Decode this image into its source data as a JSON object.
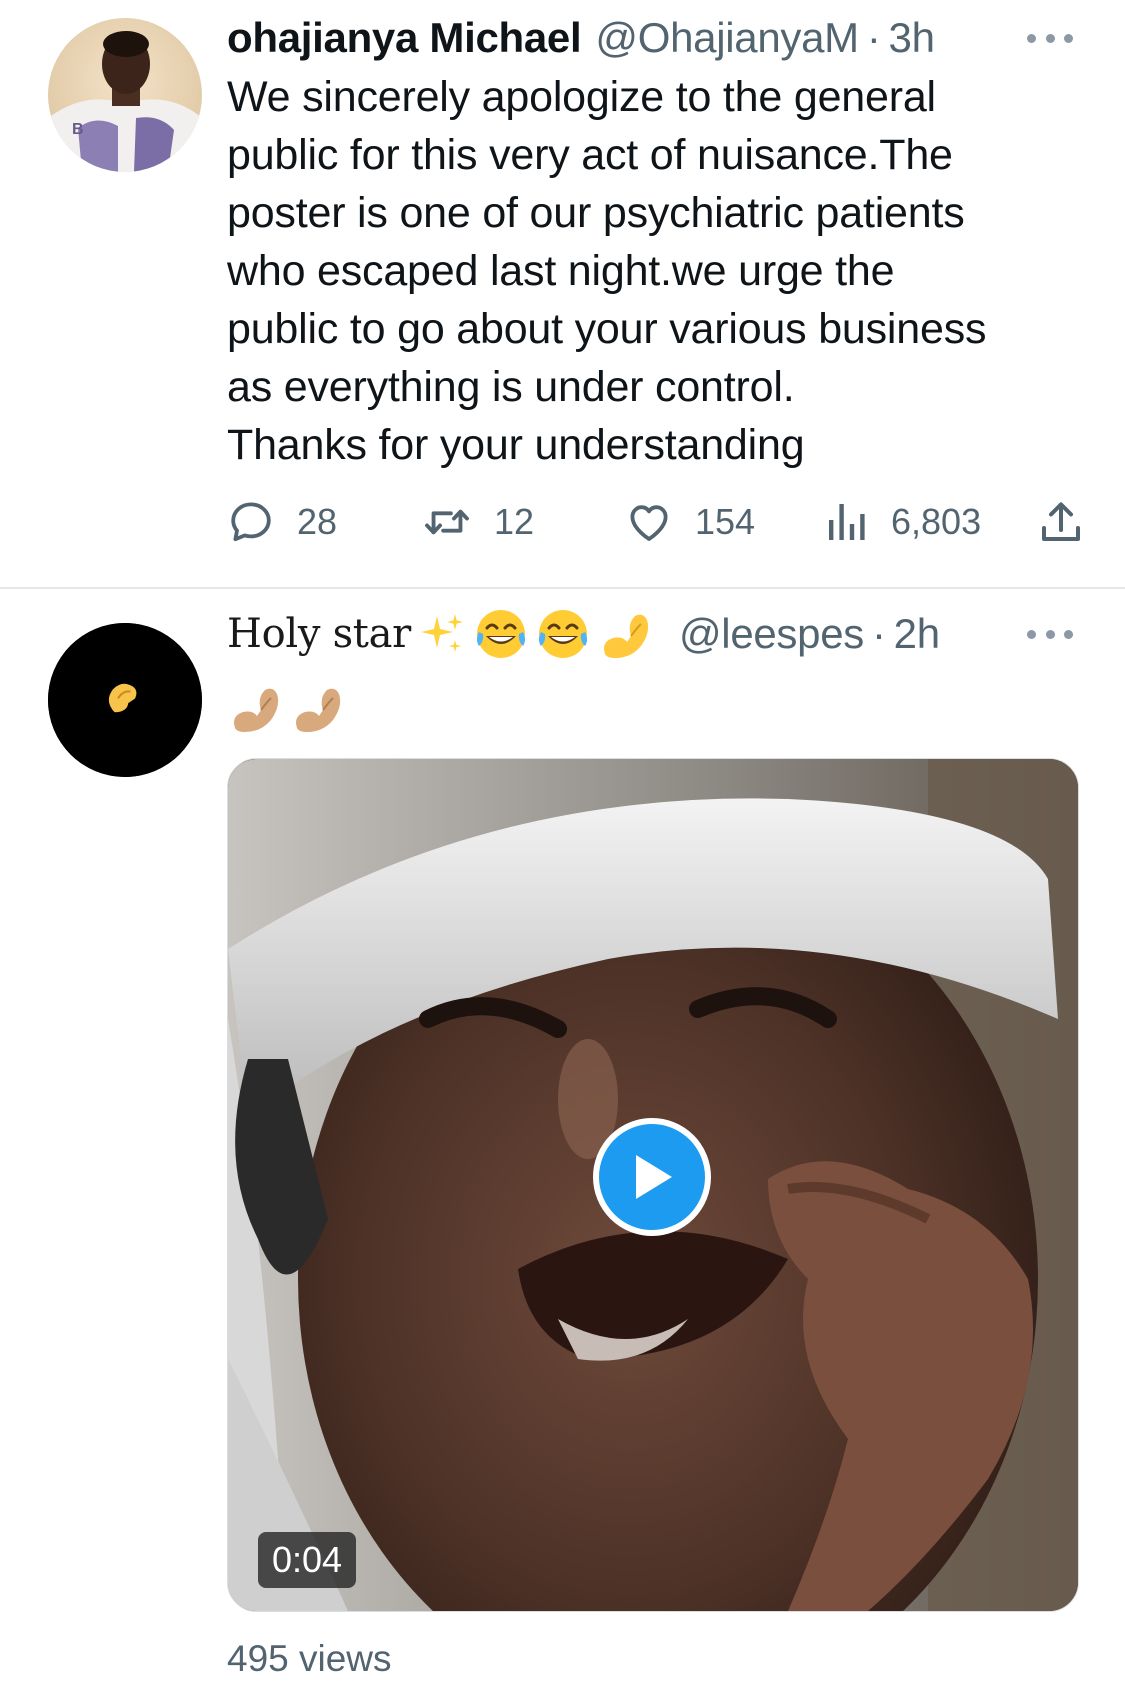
{
  "tweets": [
    {
      "display_name": "ohajianya Michael",
      "handle": "@OhajianyaM",
      "separator": "·",
      "time": "3h",
      "text": "We sincerely apologize to the general\npublic for this very act of nuisance.The\nposter is one of our psychiatric patients\nwho escaped last night.we urge the\npublic to go about your various business\nas everything is under control.\nThanks for your understanding",
      "stats": {
        "replies": "28",
        "retweets": "12",
        "likes": "154",
        "views": "6,803"
      },
      "icons": {
        "reply": "speech-bubble-icon",
        "retweet": "retweet-arrows-icon",
        "like": "heart-icon",
        "views": "bar-chart-icon",
        "share": "share-upload-icon",
        "more": "more-dots-icon"
      }
    },
    {
      "display_name": "Holy star",
      "header_emojis": [
        "sparkles",
        "tears-of-joy",
        "tears-of-joy",
        "pinching-hand"
      ],
      "handle": "@leespes",
      "separator": "·",
      "time": "2h",
      "text_emojis": [
        "pinching-hand-medium-skin",
        "pinching-hand-medium-skin"
      ],
      "video": {
        "duration": "0:04",
        "views": "495 views"
      }
    }
  ],
  "colors": {
    "text_primary": "#0f1419",
    "text_secondary": "#536471",
    "accent_blue": "#1d9bf0",
    "divider": "#e6e6e6"
  }
}
